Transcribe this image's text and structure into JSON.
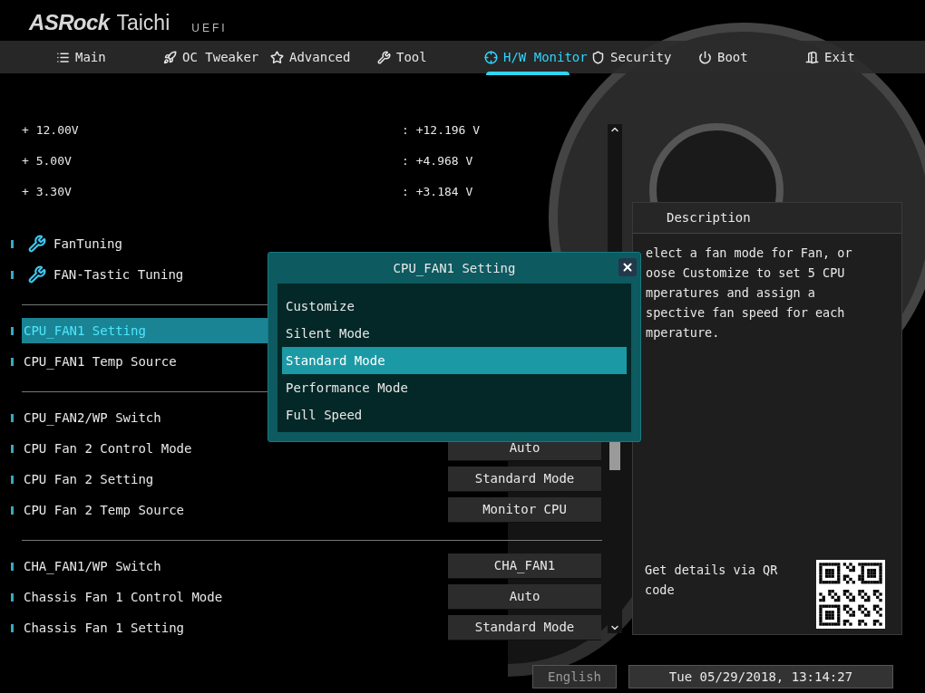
{
  "logo": {
    "brand": "ASRock",
    "model": "Taichi",
    "suffix": "UEFI"
  },
  "tabs": [
    {
      "label": "Main",
      "selected": false
    },
    {
      "label": "OC Tweaker",
      "selected": false
    },
    {
      "label": "Advanced",
      "selected": false
    },
    {
      "label": "Tool",
      "selected": false
    },
    {
      "label": "H/W Monitor",
      "selected": true
    },
    {
      "label": "Security",
      "selected": false
    },
    {
      "label": "Boot",
      "selected": false
    },
    {
      "label": "Exit",
      "selected": false
    }
  ],
  "rows": [
    {
      "kind": "voltage",
      "label": "+ 12.00V",
      "value": ": +12.196 V"
    },
    {
      "kind": "voltage",
      "label": "+ 5.00V",
      "value": ": +4.968 V"
    },
    {
      "kind": "voltage",
      "label": "+ 3.30V",
      "value": ": +3.184 V"
    },
    {
      "kind": "spacer"
    },
    {
      "kind": "tool",
      "label": "FanTuning",
      "selected": false
    },
    {
      "kind": "tool",
      "label": "FAN-Tastic Tuning",
      "selected": false
    },
    {
      "kind": "divider"
    },
    {
      "kind": "setting",
      "label": "CPU_FAN1 Setting",
      "selected": true
    },
    {
      "kind": "setting",
      "label": "CPU_FAN1 Temp Source",
      "selected": false
    },
    {
      "kind": "divider"
    },
    {
      "kind": "setting",
      "label": "CPU_FAN2/WP Switch",
      "selected": false
    },
    {
      "kind": "setting",
      "label": "CPU Fan 2 Control Mode",
      "value": "Auto",
      "selected": false
    },
    {
      "kind": "setting",
      "label": "CPU Fan 2 Setting",
      "value": "Standard Mode",
      "selected": false
    },
    {
      "kind": "setting",
      "label": "CPU Fan 2 Temp Source",
      "value": "Monitor CPU",
      "selected": false
    },
    {
      "kind": "divider"
    },
    {
      "kind": "setting",
      "label": "CHA_FAN1/WP Switch",
      "value": "CHA_FAN1",
      "selected": false
    },
    {
      "kind": "setting",
      "label": "Chassis Fan 1 Control Mode",
      "value": "Auto",
      "selected": false
    },
    {
      "kind": "setting",
      "label": "Chassis Fan 1 Setting",
      "value": "Standard Mode",
      "selected": false
    }
  ],
  "dialog": {
    "title": "CPU_FAN1 Setting",
    "options": [
      {
        "label": "Customize",
        "selected": false
      },
      {
        "label": "Silent Mode",
        "selected": false
      },
      {
        "label": "Standard Mode",
        "selected": true
      },
      {
        "label": "Performance Mode",
        "selected": false
      },
      {
        "label": "Full Speed",
        "selected": false
      }
    ]
  },
  "description": {
    "title": "Description",
    "lines": [
      "elect a fan mode for Fan, or",
      "oose Customize to set 5 CPU",
      "mperatures and assign a",
      "spective fan speed for each",
      "mperature."
    ],
    "qr_text": "Get details via QR code"
  },
  "status_bar": {
    "language": "English",
    "datetime": "Tue 05/29/2018, 13:14:27"
  }
}
